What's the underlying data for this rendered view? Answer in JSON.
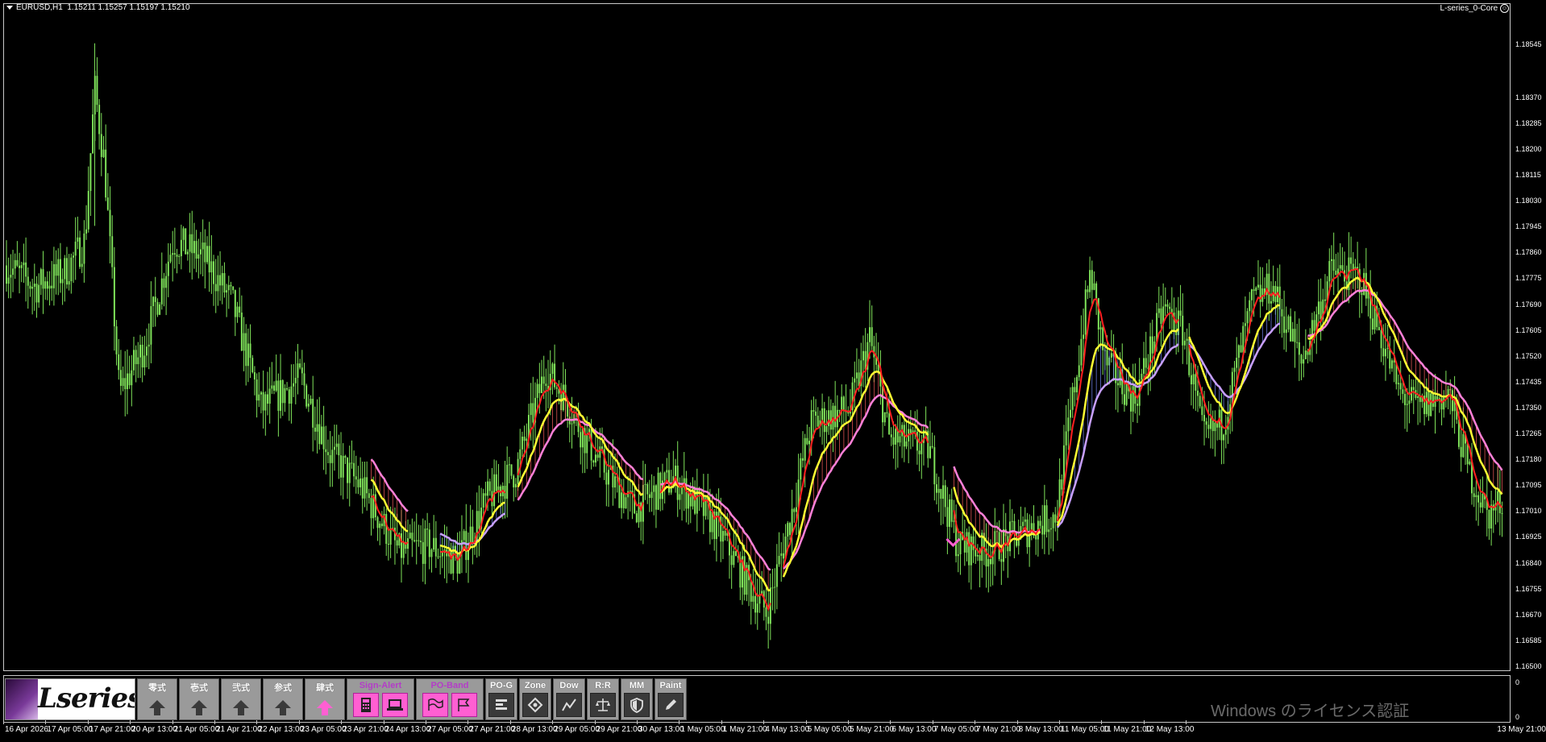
{
  "header": {
    "symbol": "EURUSD,H1",
    "ohlc": "1.15211 1.15257 1.15197 1.15210",
    "indicator_name": "L-series_0-Core",
    "indicator_icon": "smiley-icon"
  },
  "y_axis": {
    "labels": [
      "1.18545",
      "1.18370",
      "1.18285",
      "1.18200",
      "1.18115",
      "1.18030",
      "1.17945",
      "1.17860",
      "1.17775",
      "1.17690",
      "1.17605",
      "1.17520",
      "1.17435",
      "1.17350",
      "1.17265",
      "1.17180",
      "1.17095",
      "1.17010",
      "1.16925",
      "1.16840",
      "1.16755",
      "1.16670",
      "1.16585",
      "1.16500"
    ]
  },
  "subwindow": {
    "top_label": "0",
    "bottom_label": "0"
  },
  "x_axis": {
    "labels": [
      "16 Apr 2026",
      "17 Apr 05:00",
      "17 Apr 21:00",
      "20 Apr 13:00",
      "21 Apr 05:00",
      "21 Apr 21:00",
      "22 Apr 13:00",
      "23 Apr 05:00",
      "23 Apr 21:00",
      "24 Apr 13:00",
      "27 Apr 05:00",
      "27 Apr 21:00",
      "28 Apr 13:00",
      "29 Apr 05:00",
      "29 Apr 21:00",
      "30 Apr 13:00",
      "1 May 05:00",
      "1 May 21:00",
      "4 May 13:00",
      "5 May 05:00",
      "5 May 21:00",
      "6 May 13:00",
      "7 May 05:00",
      "7 May 21:00",
      "8 May 13:00",
      "11 May 05:00",
      "11 May 21:00",
      "12 May 13:00",
      "13 May 21:00"
    ]
  },
  "toolbar": {
    "logo_text": "Lseries",
    "buttons": [
      {
        "label": "零式",
        "icon": "up-arrow-icon",
        "active": false
      },
      {
        "label": "壱式",
        "icon": "up-arrow-icon",
        "active": false
      },
      {
        "label": "弐式",
        "icon": "up-arrow-icon",
        "active": false
      },
      {
        "label": "参式",
        "icon": "up-arrow-icon",
        "active": false
      },
      {
        "label": "肆式",
        "icon": "up-arrow-icon",
        "active": true
      }
    ],
    "sign_alert": {
      "label": "Sign-Alert",
      "icons": [
        "calculator-icon",
        "laptop-icon"
      ]
    },
    "po_band": {
      "label": "PO-Band",
      "icons": [
        "flag-icon",
        "flag-outline-icon"
      ]
    },
    "tools": [
      {
        "label": "PO-G",
        "icon": "bars-icon"
      },
      {
        "label": "Zone",
        "icon": "diamond-icon"
      },
      {
        "label": "Dow",
        "icon": "zigzag-icon"
      },
      {
        "label": "R:R",
        "icon": "scale-icon"
      },
      {
        "label": "MM",
        "icon": "shield-icon"
      },
      {
        "label": "Paint",
        "icon": "pencil-icon"
      }
    ]
  },
  "watermark": "Windows のライセンス認証",
  "colors": {
    "background": "#000000",
    "candle": "#7fe35a",
    "ma_fast": "#ff2020",
    "ma_mid": "#ffff33",
    "ma_slow_up": "#c8a0ff",
    "ma_slow_down": "#ff80d8",
    "fill_up": "#7a8cff",
    "fill_down": "#ff6060",
    "accent": "#ff5fd2"
  },
  "chart_data": {
    "type": "candlestick",
    "symbol": "EURUSD",
    "timeframe": "H1",
    "ylim": [
      1.165,
      1.1865
    ],
    "last_bar": {
      "open": 1.15211,
      "high": 1.15257,
      "low": 1.15197,
      "close": 1.1521
    },
    "close_path": [
      [
        0,
        1.1782
      ],
      [
        30,
        1.1775
      ],
      [
        60,
        1.178
      ],
      [
        80,
        1.179
      ],
      [
        90,
        1.184
      ],
      [
        100,
        1.1815
      ],
      [
        115,
        1.174
      ],
      [
        140,
        1.1755
      ],
      [
        170,
        1.179
      ],
      [
        200,
        1.1785
      ],
      [
        230,
        1.177
      ],
      [
        260,
        1.1735
      ],
      [
        300,
        1.1745
      ],
      [
        330,
        1.172
      ],
      [
        360,
        1.171
      ],
      [
        400,
        1.1688
      ],
      [
        430,
        1.169
      ],
      [
        460,
        1.1685
      ],
      [
        490,
        1.1705
      ],
      [
        520,
        1.1715
      ],
      [
        550,
        1.1748
      ],
      [
        570,
        1.1738
      ],
      [
        590,
        1.1725
      ],
      [
        620,
        1.171
      ],
      [
        640,
        1.1702
      ],
      [
        680,
        1.1712
      ],
      [
        720,
        1.1698
      ],
      [
        760,
        1.1675
      ],
      [
        775,
        1.1668
      ],
      [
        800,
        1.17
      ],
      [
        820,
        1.173
      ],
      [
        860,
        1.1735
      ],
      [
        880,
        1.1758
      ],
      [
        900,
        1.1725
      ],
      [
        940,
        1.1722
      ],
      [
        970,
        1.169
      ],
      [
        1000,
        1.1688
      ],
      [
        1040,
        1.1695
      ],
      [
        1070,
        1.17
      ],
      [
        1090,
        1.1745
      ],
      [
        1105,
        1.178
      ],
      [
        1120,
        1.175
      ],
      [
        1150,
        1.1738
      ],
      [
        1180,
        1.1768
      ],
      [
        1200,
        1.176
      ],
      [
        1220,
        1.1725
      ],
      [
        1240,
        1.173
      ],
      [
        1270,
        1.177
      ],
      [
        1290,
        1.1775
      ],
      [
        1320,
        1.175
      ],
      [
        1350,
        1.178
      ],
      [
        1380,
        1.1778
      ],
      [
        1400,
        1.176
      ],
      [
        1420,
        1.174
      ],
      [
        1440,
        1.1735
      ],
      [
        1470,
        1.174
      ],
      [
        1490,
        1.1715
      ],
      [
        1510,
        1.17
      ],
      [
        1525,
        1.1705
      ]
    ],
    "annotation_arrows": [
      {
        "x": 965,
        "y": 1.169,
        "color": "#ff5fd2"
      }
    ]
  }
}
